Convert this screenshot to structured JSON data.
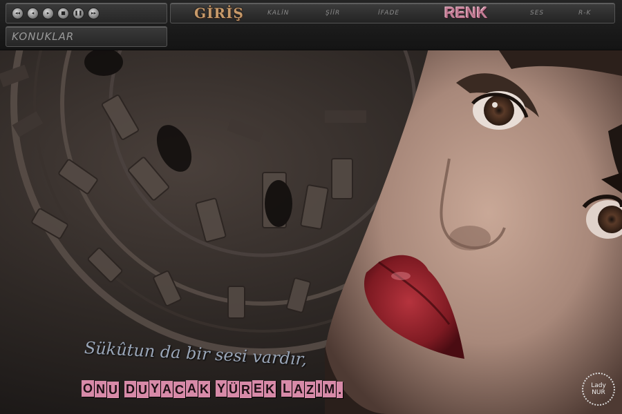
{
  "player": {
    "buttons": [
      {
        "name": "prev-track-button",
        "glyph": "◂◂"
      },
      {
        "name": "rewind-button",
        "glyph": "◂"
      },
      {
        "name": "play-button",
        "glyph": "▸"
      },
      {
        "name": "stop-button",
        "glyph": "■"
      },
      {
        "name": "pause-button",
        "glyph": "❚❚"
      },
      {
        "name": "next-track-button",
        "glyph": "▸▸"
      }
    ]
  },
  "nav": {
    "giris": "GİRİŞ",
    "items": [
      "KALİN",
      "ŞİİR",
      "İFADE",
      "RENK",
      "SES",
      "R-K"
    ]
  },
  "konuklar": "KONUKLAR",
  "quote": {
    "line1": "Sükûtun da bir sesi vardır,",
    "line2": "ONU DUYACAK YÜREK LAZIM."
  },
  "badge": {
    "line1": "Lady",
    "line2": "NUR"
  },
  "colors": {
    "accent_pink": "#d78aa8",
    "renk": "#c27b93",
    "giris": "#c79a6a"
  }
}
